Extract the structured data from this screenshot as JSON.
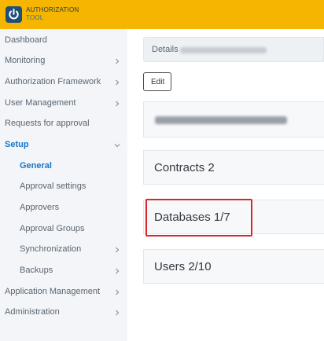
{
  "app": {
    "brand_line1": "AUTHORIZATION",
    "brand_line2": "TOOL"
  },
  "sidebar": {
    "items": [
      {
        "label": "Dashboard",
        "chevron": false
      },
      {
        "label": "Monitoring",
        "chevron": true
      },
      {
        "label": "Authorization Framework",
        "chevron": true
      },
      {
        "label": "User Management",
        "chevron": true
      },
      {
        "label": "Requests for approval",
        "chevron": false
      },
      {
        "label": "Setup",
        "chevron": true,
        "expanded": true,
        "active": true
      },
      {
        "label": "General",
        "sub": true,
        "active": true
      },
      {
        "label": "Approval settings",
        "sub": true
      },
      {
        "label": "Approvers",
        "sub": true
      },
      {
        "label": "Approval Groups",
        "sub": true
      },
      {
        "label": "Synchronization",
        "sub": true,
        "chevron": true
      },
      {
        "label": "Backups",
        "sub": true,
        "chevron": true
      },
      {
        "label": "Application Management",
        "chevron": true
      },
      {
        "label": "Administration",
        "chevron": true
      }
    ]
  },
  "details": {
    "label": "Details"
  },
  "edit_button": {
    "label": "Edit"
  },
  "cards": [
    {
      "title": "Contracts 2"
    },
    {
      "title": "Databases 1/7"
    },
    {
      "title": "Users 2/10"
    }
  ],
  "colors": {
    "topbar": "#f5b500",
    "active": "#1877c9",
    "highlight": "#d9262a"
  }
}
